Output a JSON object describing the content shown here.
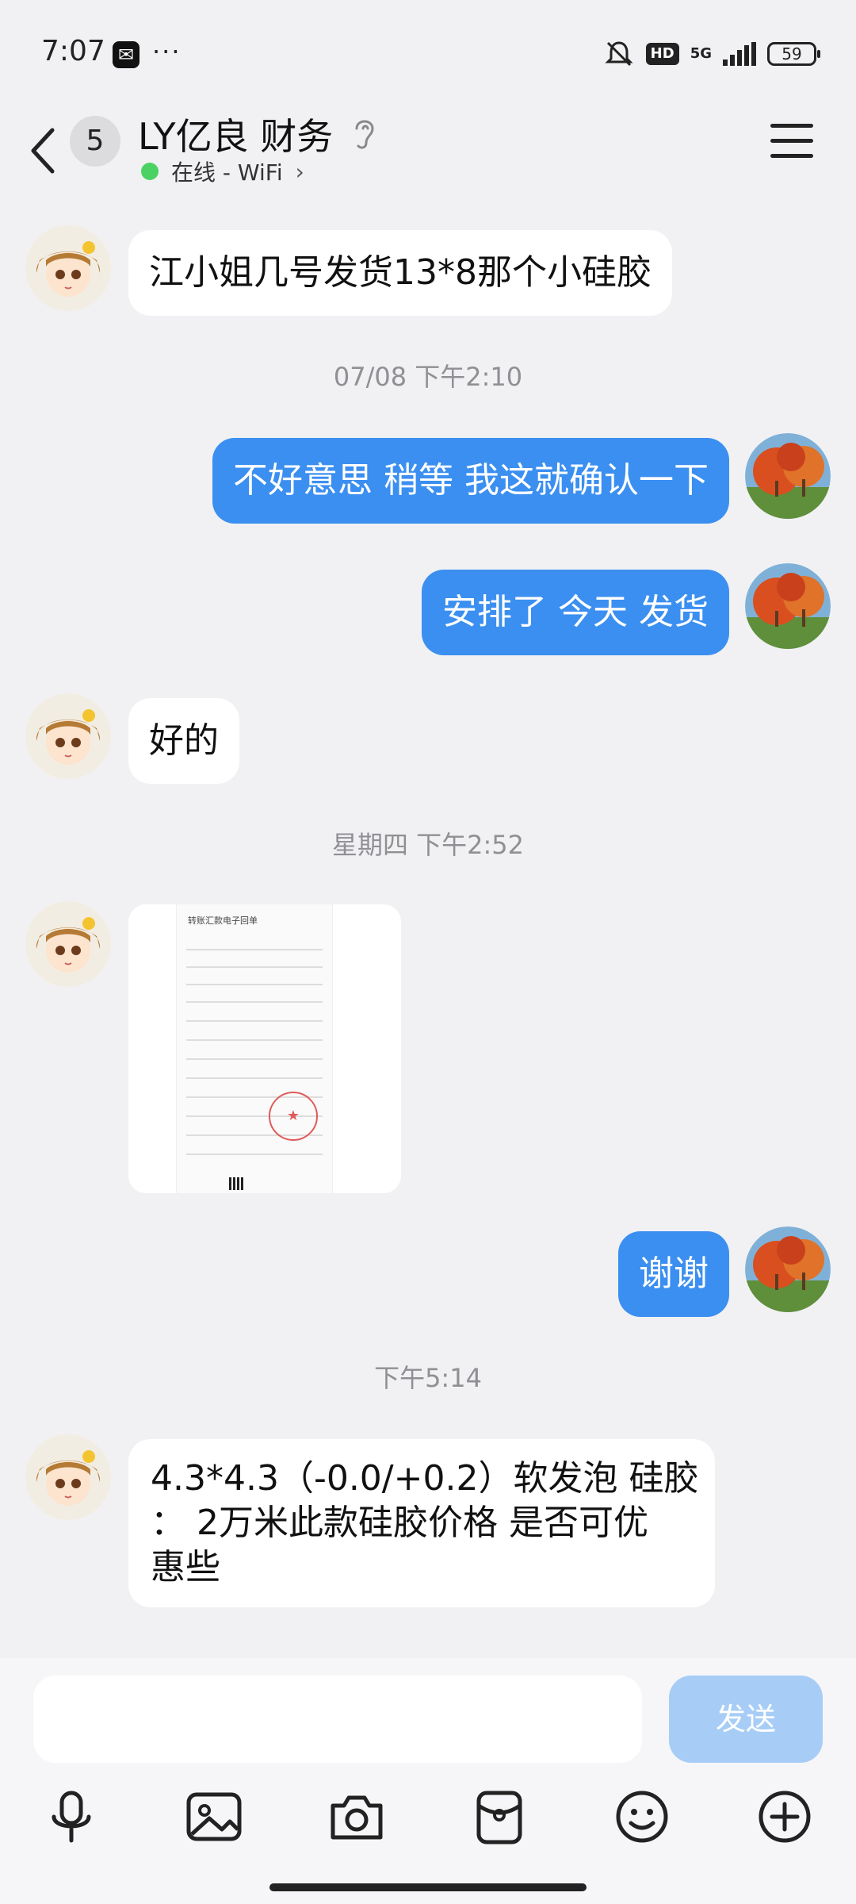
{
  "status_bar": {
    "time": "7:07",
    "dots": "···",
    "hd": "HD",
    "network": "5G",
    "battery": "59"
  },
  "header": {
    "back_count": "5",
    "contact_name": "LY亿良 财务",
    "online_status": "在线 - WiFi",
    "chevron": "›"
  },
  "messages": [
    {
      "side": "in",
      "text": "江小姐几号发货13*8那个小硅胶"
    },
    {
      "type": "time",
      "text": "07/08 下午2:10"
    },
    {
      "side": "out",
      "text": "不好意思 稍等 我这就确认一下"
    },
    {
      "side": "out",
      "text": "安排了 今天 发货"
    },
    {
      "side": "in",
      "text": "好的"
    },
    {
      "type": "time",
      "text": "星期四 下午2:52"
    },
    {
      "side": "in",
      "type": "image",
      "text": "转账汇款电子回单"
    },
    {
      "side": "out",
      "text": "谢谢"
    },
    {
      "type": "time",
      "text": "下午5:14"
    },
    {
      "side": "in",
      "lines": [
        "4.3*4.3（-0.0/+0.2）软发泡 硅胶",
        "：  2万米此款硅胶价格  是否可优",
        "惠些"
      ]
    }
  ],
  "input": {
    "placeholder": "",
    "send_label": "发送"
  },
  "toolbar": [
    "microphone-icon",
    "image-icon",
    "camera-icon",
    "red-packet-icon",
    "emoji-icon",
    "plus-icon"
  ],
  "colors": {
    "outgoing_bubble": "#3b8ff0",
    "incoming_bubble": "#ffffff",
    "send_button": "#a7cdf7",
    "online_dot": "#4cd263"
  }
}
